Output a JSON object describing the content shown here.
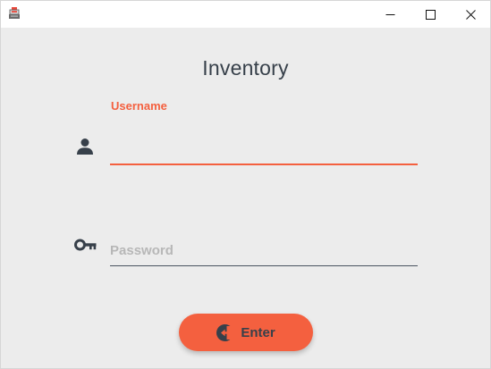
{
  "window": {
    "app_icon": "cash-register-icon",
    "controls": {
      "minimize": "minimize-icon",
      "maximize": "maximize-icon",
      "close": "close-icon"
    }
  },
  "login": {
    "title": "Inventory",
    "username": {
      "label": "Username",
      "value": "",
      "icon": "user-icon"
    },
    "password": {
      "placeholder": "Password",
      "value": "",
      "icon": "key-icon"
    },
    "enter_button": {
      "label": "Enter",
      "icon": "login-arrow-icon"
    }
  },
  "colors": {
    "accent": "#f4603f",
    "text": "#37404a",
    "background": "#ececec",
    "placeholder": "#b7b7b7"
  }
}
